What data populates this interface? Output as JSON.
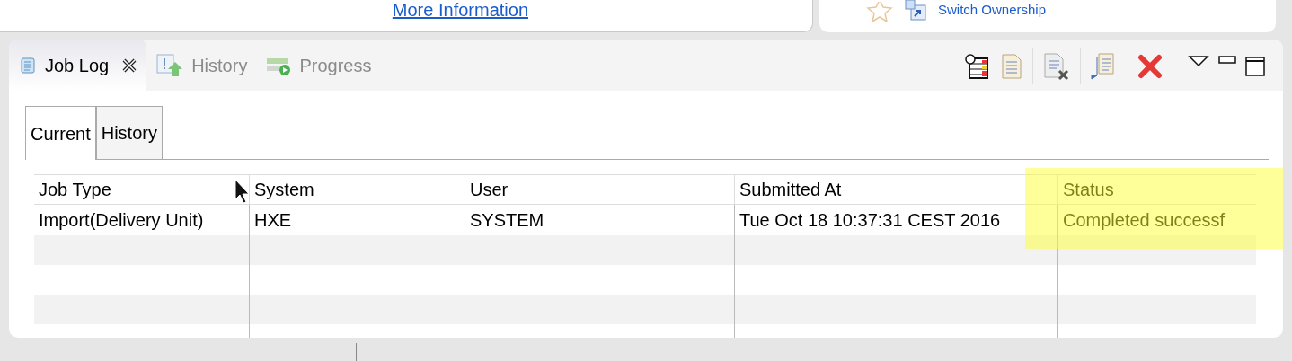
{
  "top_panel": {
    "link": "More Information"
  },
  "side_panel": {
    "action": "Switch Ownership"
  },
  "view_tabs": [
    {
      "label": "Job Log",
      "selected": true,
      "closable": true
    },
    {
      "label": "History",
      "selected": false,
      "closable": false
    },
    {
      "label": "Progress",
      "selected": false,
      "closable": false
    }
  ],
  "inner_tabs": [
    {
      "label": "Current",
      "selected": true
    },
    {
      "label": "History",
      "selected": false
    }
  ],
  "table": {
    "columns": [
      "Job Type",
      "System",
      "User",
      "Submitted At",
      "Status"
    ],
    "rows": [
      [
        "Import(Delivery Unit)",
        "HXE",
        "SYSTEM",
        "Tue Oct 18 10:37:31 CEST 2016",
        "Completed successf"
      ]
    ],
    "highlighted": true
  }
}
